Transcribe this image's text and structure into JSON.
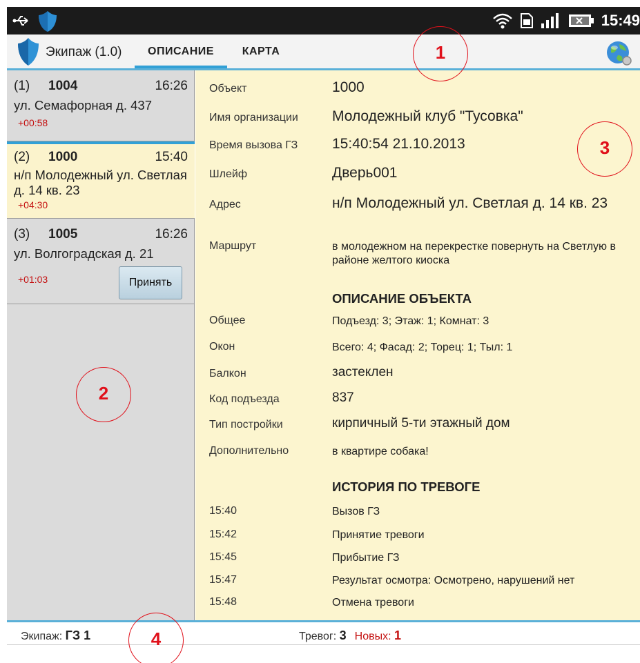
{
  "status_bar": {
    "time": "15:49",
    "icons": [
      "usb-icon",
      "app-shield-icon",
      "wifi-icon",
      "sim-icon",
      "signal-icon",
      "battery-icon"
    ]
  },
  "action_bar": {
    "app_title": "Экипаж (1.0)",
    "tabs": [
      {
        "label": "ОПИСАНИЕ",
        "active": true
      },
      {
        "label": "КАРТА",
        "active": false
      }
    ],
    "right_icon": "globe-icon"
  },
  "calls": [
    {
      "num": "(1)",
      "object": "1004",
      "time": "16:26",
      "address": "ул. Семафорная д. 437",
      "delay": "+00:58"
    },
    {
      "num": "(2)",
      "object": "1000",
      "time": "15:40",
      "address": "н/п Молодежный ул. Светлая д. 14 кв. 23",
      "delay": "+04:30",
      "selected": true
    },
    {
      "num": "(3)",
      "object": "1005",
      "time": "16:26",
      "address": "ул. Волгоградская д. 21",
      "delay": "+01:03",
      "button": "Принять"
    }
  ],
  "details": {
    "object": {
      "label": "Объект",
      "value": "1000"
    },
    "org": {
      "label": "Имя организации",
      "value": "Молодежный клуб \"Тусовка\""
    },
    "call_time": {
      "label": "Время вызова ГЗ",
      "value": "15:40:54 21.10.2013"
    },
    "loop": {
      "label": "Шлейф",
      "value": "Дверь001"
    },
    "address": {
      "label": "Адрес",
      "value": "н/п Молодежный ул. Светлая д. 14 кв. 23"
    },
    "route": {
      "label": "Маршрут",
      "value": "в молодежном на перекрестке повернуть на Светлую в районе желтого киоска"
    }
  },
  "object_section": {
    "title": "ОПИСАНИЕ ОБЪЕКТА",
    "general": {
      "label": "Общее",
      "value": "Подъезд: 3; Этаж: 1; Комнат: 3"
    },
    "windows": {
      "label": "Окон",
      "value": "Всего: 4; Фасад: 2; Торец: 1; Тыл: 1"
    },
    "balcony": {
      "label": "Балкон",
      "value": "застеклен"
    },
    "door_code": {
      "label": "Код подъезда",
      "value": "837"
    },
    "building": {
      "label": "Тип постройки",
      "value": "кирпичный 5-ти этажный дом"
    },
    "extra": {
      "label": "Дополнительно",
      "value": "в квартире собака!"
    }
  },
  "history": {
    "title": "ИСТОРИЯ ПО ТРЕВОГЕ",
    "events": [
      {
        "time": "15:40",
        "text": "Вызов ГЗ"
      },
      {
        "time": "15:42",
        "text": "Принятие тревоги"
      },
      {
        "time": "15:45",
        "text": "Прибытие ГЗ"
      },
      {
        "time": "15:47",
        "text": "Результат осмотра: Осмотрено, нарушений нет"
      },
      {
        "time": "15:48",
        "text": "Отмена тревоги"
      }
    ]
  },
  "bottom_bar": {
    "crew_label": "Экипаж:",
    "crew_value": "ГЗ 1",
    "alarms_label": "Тревог:",
    "alarms_value": "3",
    "new_label": "Новых:",
    "new_value": "1"
  },
  "annotations": [
    "1",
    "2",
    "3",
    "4"
  ],
  "colors": {
    "accent": "#32a0d6",
    "alert": "#c41212",
    "detail_bg": "#fcf5cf",
    "list_bg": "#dbdbdb",
    "annotation": "#e0101a"
  }
}
